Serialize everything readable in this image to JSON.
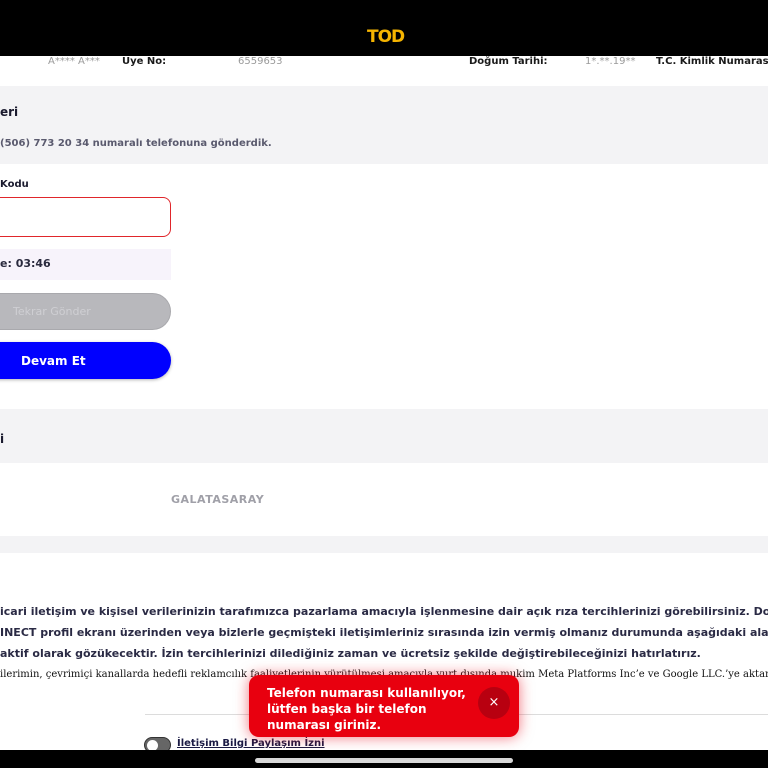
{
  "app": {
    "logo": "TOD"
  },
  "member": {
    "name_masked": "A**** A***",
    "member_no_label": "Üye No:",
    "member_no_value": "6559653",
    "birth_label": "Doğum Tarihi:",
    "birth_value": "1*.**.19**",
    "tc_label": "T.C. Kimlik Numaras"
  },
  "verification": {
    "section_title": "eri",
    "sent_message": "(506) 773 20 34 numaralı telefonuna gönderdik.",
    "code_label": "Kodu",
    "code_value": "",
    "timer_text": "e: 03:46",
    "resend_label": "Tekrar Gönder",
    "continue_label": "Devam Et"
  },
  "team": {
    "section_title": "i",
    "team_name": "GALATASARAY"
  },
  "consent": {
    "line1": "icari iletişim ve kişisel verilerinizin tarafımızca pazarlama amacıyla işlenmesine dair açık rıza tercihlerinizi görebilirsiniz. Doğ",
    "line2": "INECT profil ekranı üzerinden veya bizlerle geçmişteki iletişimleriniz sırasında izin vermiş olmanız durumunda aşağıdaki alan",
    "line3": " aktif olarak gözükecektir. İzin tercihlerinizi dilediğiniz zaman ve ücretsiz şekilde değiştirebileceğinizi hatırlatırız.",
    "line4": "ilerimin, çevrimiçi kanallarda hedefli reklamcılık faaliyetlerinin yürütülmesi amacıyla yurt dışında mukim Meta Platforms Inc’e ve Google LLC.’ye aktarılması",
    "toggle_label": "İletişim Bilgi Paylaşım İzni"
  },
  "toast": {
    "message": "Telefon numarası kullanılıyor, lütfen başka bir telefon numarası giriniz.",
    "close_symbol": "×"
  },
  "colors": {
    "accent_blue": "#0000ff",
    "error_red": "#e8000f",
    "logo_yellow": "#f5b400"
  }
}
